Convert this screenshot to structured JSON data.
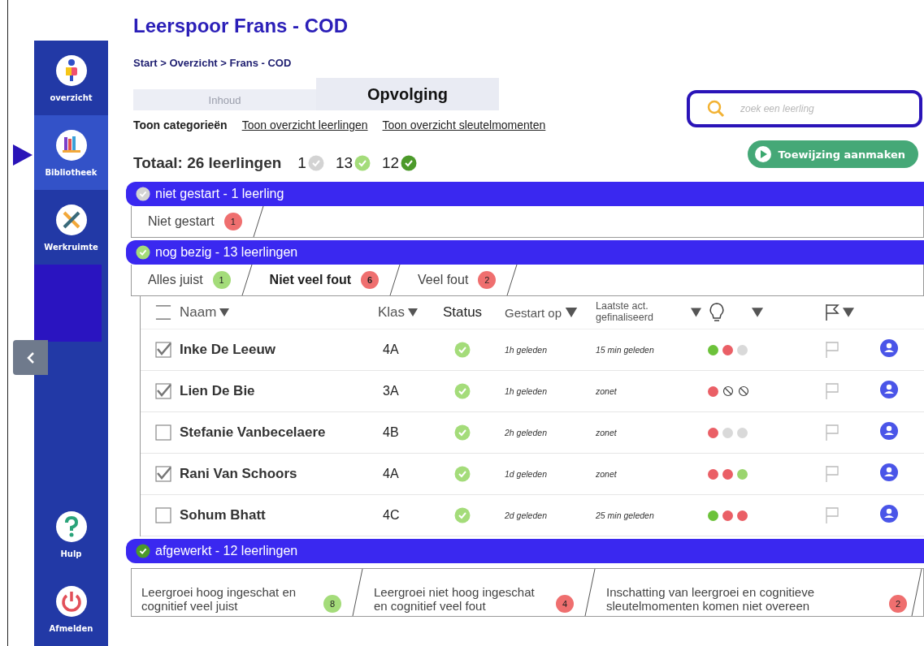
{
  "sidebar": {
    "items": [
      {
        "label": "overzicht",
        "selected": false
      },
      {
        "label": "Bibliotheek",
        "selected": true
      },
      {
        "label": "Werkruimte",
        "selected": false
      }
    ],
    "bottom_items": [
      {
        "label": "Hulp"
      },
      {
        "label": "Afmelden"
      }
    ]
  },
  "title": "Leerspoor Frans - COD",
  "breadcrumb": "Start > Overzicht > Frans - COD",
  "tabs": [
    {
      "label": "Inhoud",
      "selected": false
    },
    {
      "label": "Opvolging",
      "selected": true
    }
  ],
  "view_links": [
    {
      "label": "Toon categorieën",
      "selected": true
    },
    {
      "label": "Toon overzicht  leerlingen",
      "selected": false
    },
    {
      "label": "Toon overzicht sleutelmomenten",
      "selected": false
    }
  ],
  "search": {
    "placeholder": "zoek een leerling"
  },
  "total": "Totaal: 26 leerlingen",
  "counts": [
    {
      "count": "1",
      "color": "#d3d3d3"
    },
    {
      "count": "13",
      "color": "#a4dc7a"
    },
    {
      "count": "12",
      "color": "#4c9a2a"
    }
  ],
  "assign_button": "Toewijzing aanmaken",
  "groups": [
    {
      "title": "niet gestart - 1 leerling",
      "color": "#d3d3d3",
      "subtabs": [
        {
          "label": "Niet gestart",
          "count": "1",
          "color": "#ef6f6f",
          "selected": false
        }
      ]
    },
    {
      "title": "nog bezig - 13 leerlingen",
      "color": "#a4dc7a",
      "subtabs": [
        {
          "label": "Alles juist",
          "count": "1",
          "color": "#a4dc7a",
          "selected": false
        },
        {
          "label": "Niet veel fout",
          "count": "6",
          "color": "#ef6f6f",
          "selected": true
        },
        {
          "label": "Veel fout",
          "count": "2",
          "color": "#ef6f6f",
          "selected": false
        }
      ],
      "table": {
        "columns": [
          "Naam",
          "Klas",
          "Status",
          "Gestart op",
          "Laatste act. gefinaliseerd"
        ],
        "rows": [
          {
            "checked": true,
            "name": "Inke De Leeuw",
            "klas": "4A",
            "started_ok": true,
            "started": "1h geleden",
            "last": "15 min geleden",
            "dots": [
              {
                "kind": "dot",
                "color": "#6cc23a"
              },
              {
                "kind": "dot",
                "color": "#ea5f66"
              },
              {
                "kind": "dot",
                "color": "#d9d9d9"
              }
            ]
          },
          {
            "checked": true,
            "name": "Lien De Bie",
            "klas": "3A",
            "started_ok": true,
            "started": "1h geleden",
            "last": "zonet",
            "dots": [
              {
                "kind": "dot",
                "color": "#ea5f66"
              },
              {
                "kind": "blocked"
              },
              {
                "kind": "blocked"
              }
            ]
          },
          {
            "checked": false,
            "name": "Stefanie Vanbecelaere",
            "klas": "4B",
            "started_ok": true,
            "started": "2h geleden",
            "last": "zonet",
            "dots": [
              {
                "kind": "dot",
                "color": "#ea5f66"
              },
              {
                "kind": "dot",
                "color": "#d9d9d9"
              },
              {
                "kind": "dot",
                "color": "#d9d9d9"
              }
            ]
          },
          {
            "checked": true,
            "name": "Rani Van Schoors",
            "klas": "4A",
            "started_ok": true,
            "started": "1d geleden",
            "last": "zonet",
            "dots": [
              {
                "kind": "dot",
                "color": "#ea5f66"
              },
              {
                "kind": "dot",
                "color": "#ea5f66"
              },
              {
                "kind": "dot",
                "color": "#9bd56e"
              }
            ]
          },
          {
            "checked": false,
            "name": "Sohum Bhatt",
            "klas": "4C",
            "started_ok": true,
            "started": "2d geleden",
            "last": "25 min geleden",
            "dots": [
              {
                "kind": "dot",
                "color": "#6cc23a"
              },
              {
                "kind": "dot",
                "color": "#ea5f66"
              },
              {
                "kind": "dot",
                "color": "#ea5f66"
              }
            ]
          }
        ]
      }
    },
    {
      "title": "afgewerkt  - 12 leerlingen",
      "color": "#4c9a2a",
      "subtabs": [
        {
          "label": "Leergroei hoog ingeschat en cognitief veel juist",
          "count": "8",
          "color": "#a4dc7a",
          "selected": false
        },
        {
          "label": "Leergroei niet hoog ingeschat en cognitief veel fout",
          "count": "4",
          "color": "#ef6f6f",
          "selected": false
        },
        {
          "label": "Inschatting van  leergroei en cognitieve sleutelmomenten komen niet overeen",
          "count": "2",
          "color": "#ef6f6f",
          "selected": false
        }
      ]
    }
  ]
}
